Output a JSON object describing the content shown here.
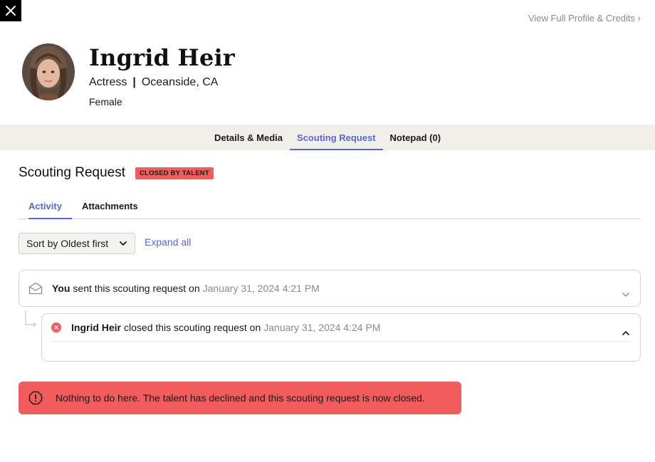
{
  "header": {
    "close_icon": "close-icon",
    "full_profile_link": "View Full Profile & Credits",
    "full_profile_chevron": "›"
  },
  "profile": {
    "name": "Ingrid Heir",
    "role": "Actress",
    "separator": "|",
    "location": "Oceanside, CA",
    "gender": "Female"
  },
  "tabs": [
    {
      "label": "Details & Media",
      "active": false
    },
    {
      "label": "Scouting Request",
      "active": true
    },
    {
      "label": "Notepad (0)",
      "active": false
    }
  ],
  "section": {
    "title": "Scouting Request",
    "status_badge": "CLOSED BY TALENT",
    "status_color": "#f25c5c"
  },
  "subtabs": [
    {
      "label": "Activity",
      "active": true
    },
    {
      "label": "Attachments",
      "active": false
    }
  ],
  "controls": {
    "sort_value": "Sort by Oldest first",
    "expand_all": "Expand all"
  },
  "activity": [
    {
      "icon": "envelope-icon",
      "actor": "You",
      "action": "sent this scouting request on",
      "date": "January 31, 2024 4:21 PM",
      "expanded": false
    },
    {
      "icon": "x-circle-icon",
      "actor": "Ingrid Heir",
      "action": "closed this scouting request on",
      "date": "January 31, 2024 4:24 PM",
      "expanded": true
    }
  ],
  "alert": {
    "icon": "alert-octagon-icon",
    "message": "Nothing to do here. The talent has declined and this scouting request is now closed.",
    "color": "#f25c5c"
  },
  "colors": {
    "accent": "#5668d8",
    "tabbar_bg": "#f0efea",
    "muted_text": "#8a8a8a"
  }
}
